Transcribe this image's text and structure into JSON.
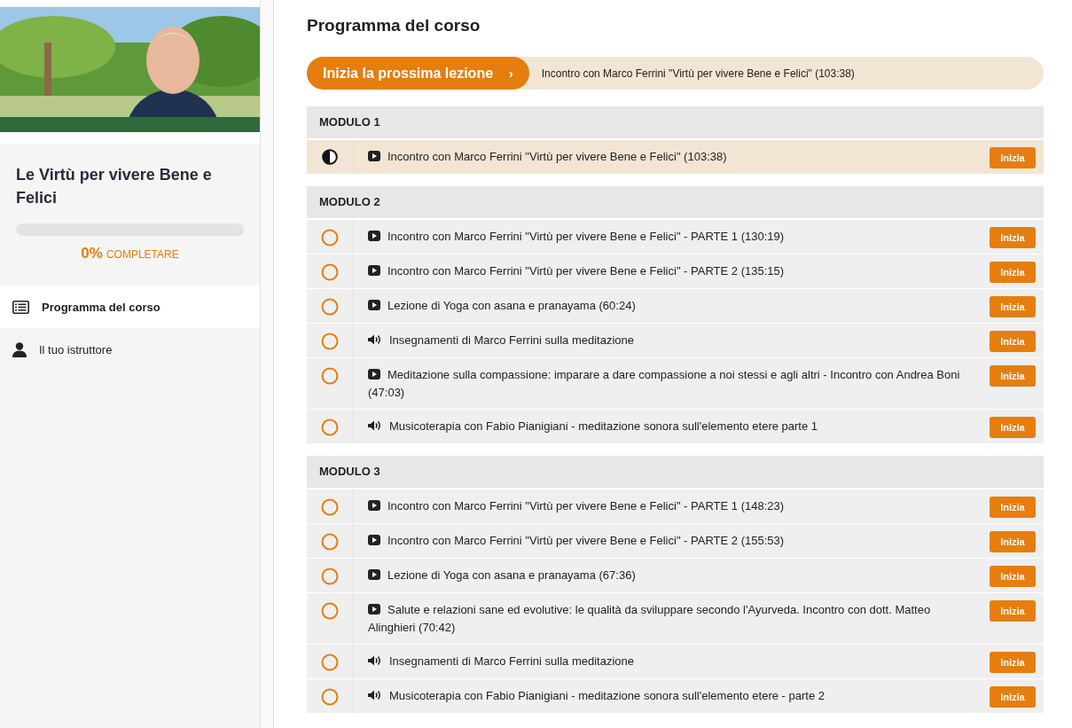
{
  "sidebar": {
    "course_title": "Le Virtù per vivere Bene e Felici",
    "progress": {
      "level": 0,
      "percent": "0%",
      "label": "COMPLETARE"
    },
    "nav": [
      {
        "label": "Programma del corso",
        "selected": true
      },
      {
        "label": "Il tuo istruttore",
        "selected": false
      }
    ]
  },
  "main": {
    "title": "Programma del corso",
    "next_lesson": {
      "button": "Inizia la prossima lezione",
      "arrow": "›",
      "lesson": "Incontro con Marco Ferrini \"Virtù per vivere Bene e Felici\" (103:38)"
    },
    "modules": [
      {
        "title": "MODULO 1",
        "lessons": [
          {
            "kind": "video",
            "started": true,
            "selected": true,
            "title": "Incontro con Marco Ferrini \"Virtù per vivere Bene e Felici\" (103:38)",
            "button": "Inizia"
          }
        ]
      },
      {
        "title": "MODULO 2",
        "lessons": [
          {
            "kind": "video",
            "started": false,
            "selected": false,
            "title": "Incontro con Marco Ferrini \"Virtù per vivere Bene e Felici\" - PARTE 1 (130:19)",
            "button": "Inizia"
          },
          {
            "kind": "video",
            "started": false,
            "selected": false,
            "title": "Incontro con Marco Ferrini \"Virtù per vivere Bene e Felici\" - PARTE 2 (135:15)",
            "button": "Inizia"
          },
          {
            "kind": "video",
            "started": false,
            "selected": false,
            "title": "Lezione di Yoga con asana e pranayama (60:24)",
            "button": "Inizia"
          },
          {
            "kind": "audio",
            "started": false,
            "selected": false,
            "title": "Insegnamenti di Marco Ferrini sulla meditazione",
            "button": "Inizia"
          },
          {
            "kind": "video",
            "started": false,
            "selected": false,
            "title": "Meditazione sulla compassione: imparare a dare compassione a noi stessi e agli altri - Incontro con Andrea Boni (47:03)",
            "button": "Inizia"
          },
          {
            "kind": "audio",
            "started": false,
            "selected": false,
            "title": "Musicoterapia con Fabio Pianigiani - meditazione sonora sull'elemento etere parte 1",
            "button": "Inizia"
          }
        ]
      },
      {
        "title": "MODULO 3",
        "lessons": [
          {
            "kind": "video",
            "started": false,
            "selected": false,
            "title": "Incontro con Marco Ferrini \"Virtù per vivere Bene e Felici\" - PARTE 1 (148:23)",
            "button": "Inizia"
          },
          {
            "kind": "video",
            "started": false,
            "selected": false,
            "title": "Incontro con Marco Ferrini \"Virtù per vivere Bene e Felici\" - PARTE 2 (155:53)",
            "button": "Inizia"
          },
          {
            "kind": "video",
            "started": false,
            "selected": false,
            "title": "Lezione di Yoga con asana e pranayama (67:36)",
            "button": "Inizia"
          },
          {
            "kind": "video",
            "started": false,
            "selected": false,
            "title": "Salute e relazioni sane ed evolutive: le qualità da sviluppare secondo l'Ayurveda. Incontro con dott. Matteo Alinghieri (70:42)",
            "button": "Inizia"
          },
          {
            "kind": "audio",
            "started": false,
            "selected": false,
            "title": "Insegnamenti di Marco Ferrini sulla meditazione",
            "button": "Inizia"
          },
          {
            "kind": "audio",
            "started": false,
            "selected": false,
            "title": "Musicoterapia con Fabio Pianigiani - meditazione sonora sull'elemento etere - parte 2",
            "button": "Inizia"
          }
        ]
      }
    ]
  }
}
